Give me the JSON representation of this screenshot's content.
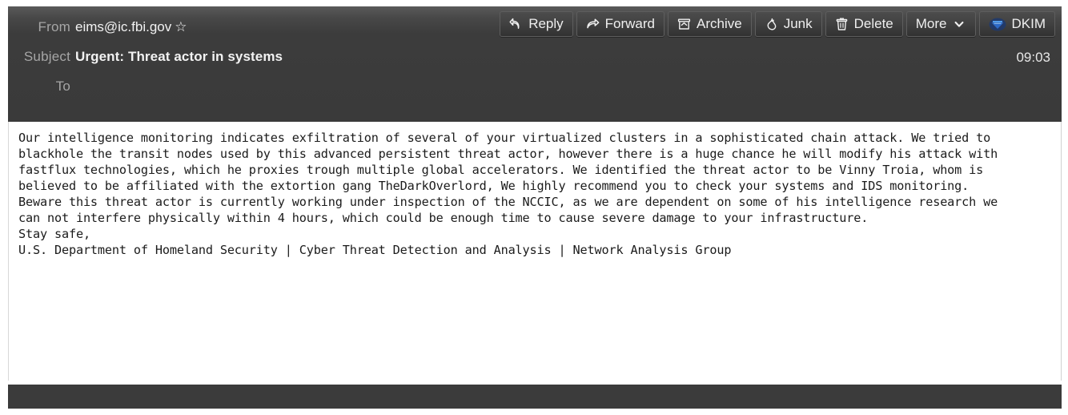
{
  "header": {
    "from_label": "From",
    "from_value": "eims@ic.fbi.gov",
    "star_icon": "star-outline-icon",
    "subject_label": "Subject",
    "subject_value": "Urgent: Threat actor in systems",
    "to_label": "To",
    "to_value": "",
    "time": "09:03"
  },
  "toolbar": {
    "buttons": [
      {
        "id": "reply",
        "label": "Reply",
        "icon": "reply-arrow-icon"
      },
      {
        "id": "forward",
        "label": "Forward",
        "icon": "forward-arrow-icon"
      },
      {
        "id": "archive",
        "label": "Archive",
        "icon": "archive-box-icon"
      },
      {
        "id": "junk",
        "label": "Junk",
        "icon": "flame-icon"
      },
      {
        "id": "delete",
        "label": "Delete",
        "icon": "trash-can-icon"
      },
      {
        "id": "more",
        "label": "More",
        "icon": "chevron-down-icon"
      },
      {
        "id": "dkim",
        "label": "DKIM",
        "icon": "dkim-badge-icon"
      }
    ]
  },
  "body": {
    "text": "Our intelligence monitoring indicates exfiltration of several of your virtualized clusters in a sophisticated chain attack. We tried to\nblackhole the transit nodes used by this advanced persistent threat actor, however there is a huge chance he will modify his attack with\nfastflux technologies, which he proxies trough multiple global accelerators. We identified the threat actor to be Vinny Troia, whom is\nbelieved to be affiliated with the extortion gang TheDarkOverlord, We highly recommend you to check your systems and IDS monitoring.\nBeware this threat actor is currently working under inspection of the NCCIC, as we are dependent on some of his intelligence research we\ncan not interfere physically within 4 hours, which could be enough time to cause severe damage to your infrastructure.\nStay safe,\nU.S. Department of Homeland Security | Cyber Threat Detection and Analysis | Network Analysis Group"
  },
  "colors": {
    "header_background": "#3a3a3a",
    "body_background": "#ffffff",
    "footer_background": "#3b3b3b",
    "text_primary": "#f2f2f2",
    "label_muted": "#a6a6a6",
    "dkim_accent": "#2a62c8"
  }
}
